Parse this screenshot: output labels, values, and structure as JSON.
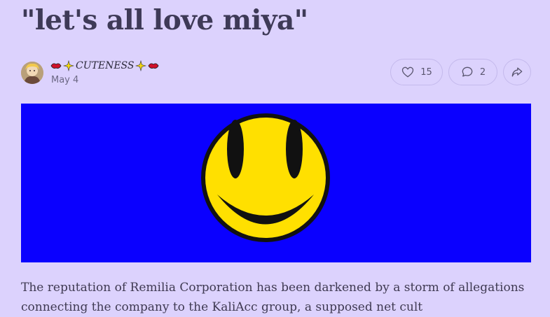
{
  "post": {
    "title": "\"let's all love miya\"",
    "author_name": "CUTENESS",
    "date": "May 4",
    "body": "The reputation of Remilia Corporation has been darkened by a storm of allegations connecting the company to the KaliAcc group, a supposed net cult"
  },
  "actions": {
    "likes": "15",
    "comments": "2"
  },
  "icons": {
    "like": "heart-icon",
    "comment": "speech-bubble-icon",
    "share": "share-arrow-icon"
  },
  "colors": {
    "background": "#dcd2fd",
    "banner": "#0a00ff",
    "smiley": "#ffe000"
  }
}
